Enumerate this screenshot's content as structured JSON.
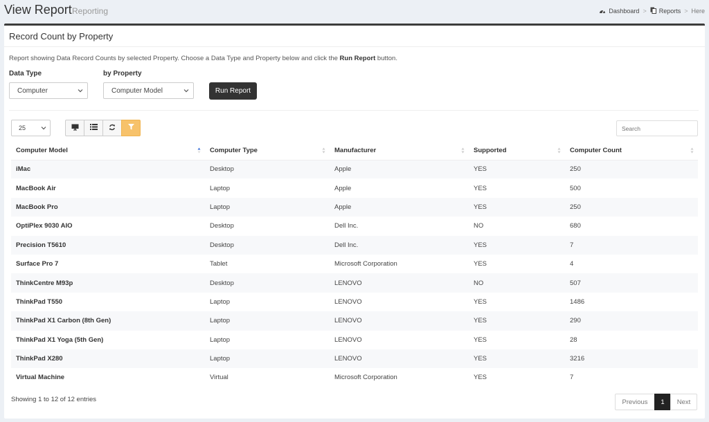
{
  "header": {
    "title": "View Report",
    "subtitle": "Reporting",
    "breadcrumb": [
      {
        "label": "Dashboard",
        "icon": "dashboard-icon"
      },
      {
        "label": "Reports",
        "icon": "copy-icon"
      },
      {
        "label": "Here"
      }
    ]
  },
  "box": {
    "title": "Record Count by Property",
    "description_prefix": "Report showing Data Record Counts by selected Property.  Choose a Data Type and Property below and click the ",
    "description_bold": "Run Report",
    "description_suffix": " button."
  },
  "form": {
    "data_type_label": "Data Type",
    "data_type_value": "Computer",
    "property_label": "by Property",
    "property_value": "Computer Model",
    "run_button": "Run Report"
  },
  "controls": {
    "page_length": "25",
    "tools": [
      "monitor-icon",
      "list-icon",
      "refresh-icon",
      "filter-icon"
    ],
    "search_placeholder": "Search"
  },
  "table": {
    "columns": [
      "Computer Model",
      "Computer Type",
      "Manufacturer",
      "Supported",
      "Computer Count"
    ],
    "rows": [
      [
        "iMac",
        "Desktop",
        "Apple",
        "YES",
        "250"
      ],
      [
        "MacBook Air",
        "Laptop",
        "Apple",
        "YES",
        "500"
      ],
      [
        "MacBook Pro",
        "Laptop",
        "Apple",
        "YES",
        "250"
      ],
      [
        "OptiPlex 9030 AIO",
        "Desktop",
        "Dell Inc.",
        "NO",
        "680"
      ],
      [
        "Precision T5610",
        "Desktop",
        "Dell Inc.",
        "YES",
        "7"
      ],
      [
        "Surface Pro 7",
        "Tablet",
        "Microsoft Corporation",
        "YES",
        "4"
      ],
      [
        "ThinkCentre M93p",
        "Desktop",
        "LENOVO",
        "NO",
        "507"
      ],
      [
        "ThinkPad T550",
        "Laptop",
        "LENOVO",
        "YES",
        "1486"
      ],
      [
        "ThinkPad X1 Carbon (8th Gen)",
        "Laptop",
        "LENOVO",
        "YES",
        "290"
      ],
      [
        "ThinkPad X1 Yoga (5th Gen)",
        "Laptop",
        "LENOVO",
        "YES",
        "28"
      ],
      [
        "ThinkPad X280",
        "Laptop",
        "LENOVO",
        "YES",
        "3216"
      ],
      [
        "Virtual Machine",
        "Virtual",
        "Microsoft Corporation",
        "YES",
        "7"
      ]
    ]
  },
  "footer": {
    "info": "Showing 1 to 12 of 12 entries",
    "prev": "Previous",
    "current_page": "1",
    "next": "Next"
  },
  "colors": {
    "accent_filter": "#f7c26b",
    "dark_button": "#333333",
    "box_border": "#3c3c3c"
  }
}
